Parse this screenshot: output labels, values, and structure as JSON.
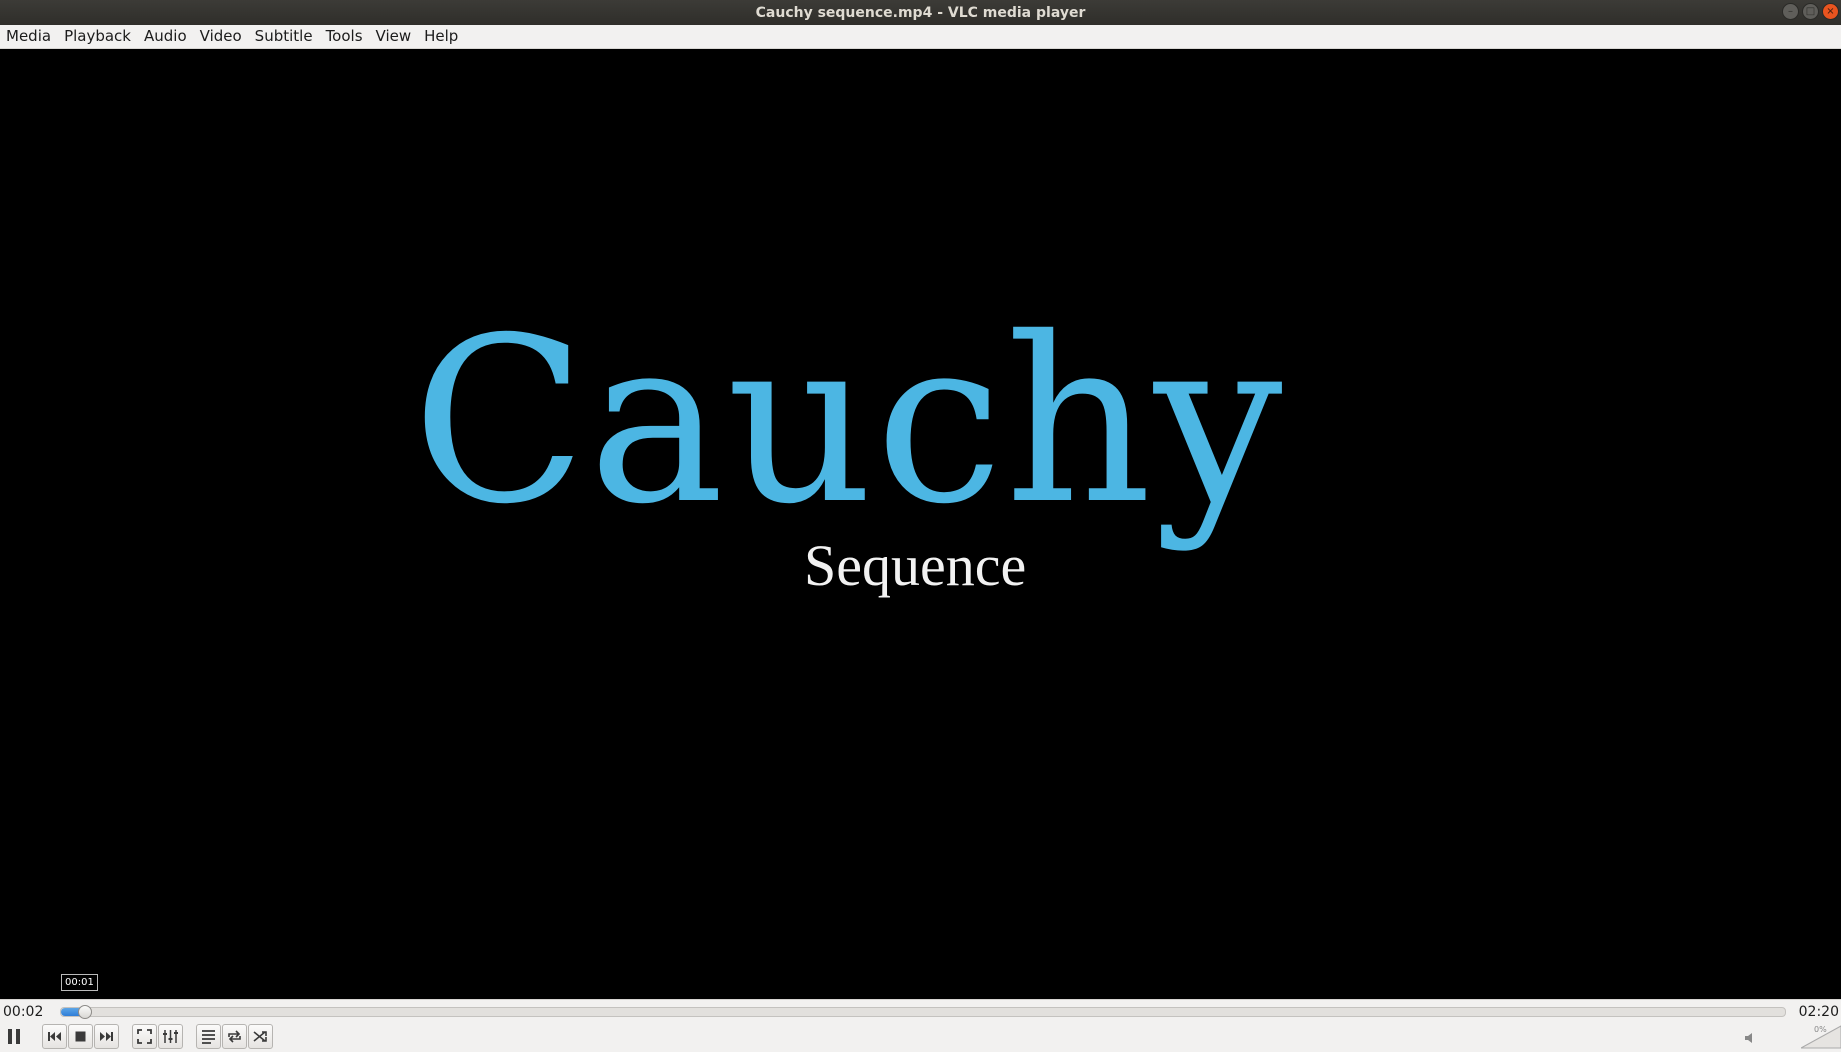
{
  "window": {
    "title": "Cauchy sequence.mp4 - VLC media player",
    "buttons": [
      "minimize-icon",
      "maximize-icon",
      "close-icon"
    ]
  },
  "menubar": {
    "items": [
      {
        "label": "Media"
      },
      {
        "label": "Playback"
      },
      {
        "label": "Audio"
      },
      {
        "label": "Video"
      },
      {
        "label": "Subtitle"
      },
      {
        "label": "Tools"
      },
      {
        "label": "View"
      },
      {
        "label": "Help"
      }
    ]
  },
  "video": {
    "main_text": "Cauchy",
    "sub_text": "Sequence",
    "main_color": "#4cb6e3",
    "sub_color": "#f2f2f2"
  },
  "tooltip": {
    "text": "00:01"
  },
  "controls": {
    "elapsed": "00:02",
    "total": "02:20",
    "progress_fraction": 0.014,
    "accent_color": "#2f7ed8",
    "volume_label": "0%",
    "buttons": [
      {
        "name": "pause-button",
        "icon": "pause-icon"
      },
      {
        "name": "previous-button",
        "icon": "skip-previous-icon"
      },
      {
        "name": "stop-button",
        "icon": "stop-icon"
      },
      {
        "name": "next-button",
        "icon": "skip-next-icon"
      },
      {
        "name": "fullscreen-button",
        "icon": "fullscreen-icon"
      },
      {
        "name": "extended-settings-button",
        "icon": "equalizer-icon"
      },
      {
        "name": "playlist-button",
        "icon": "playlist-icon"
      },
      {
        "name": "loop-button",
        "icon": "loop-icon"
      },
      {
        "name": "shuffle-button",
        "icon": "shuffle-icon"
      }
    ]
  }
}
